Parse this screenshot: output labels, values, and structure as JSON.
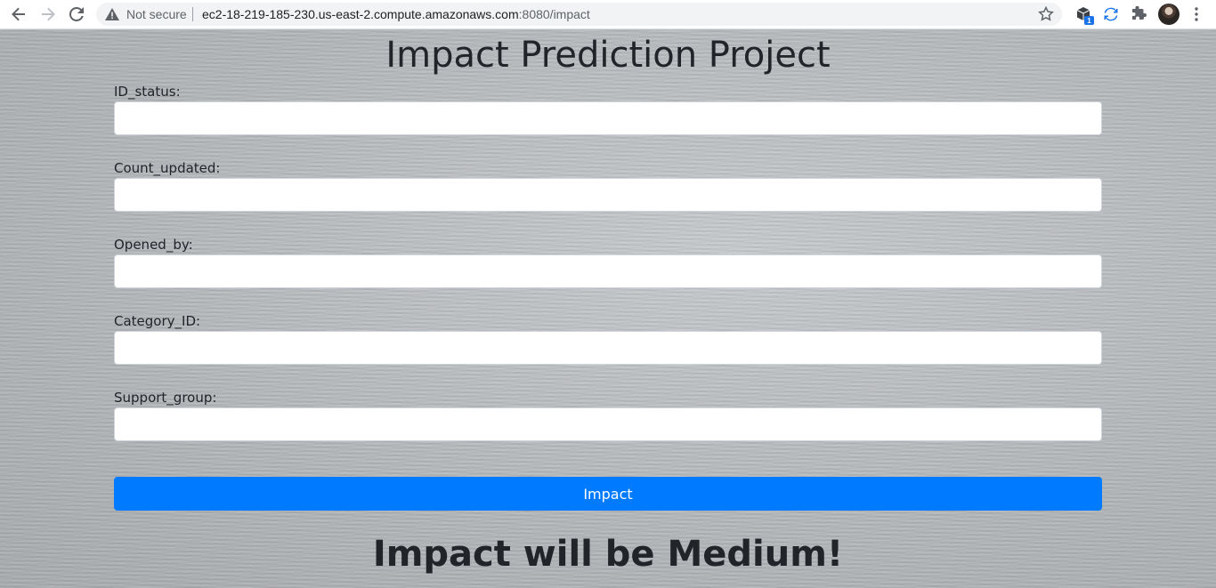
{
  "browser": {
    "security_label": "Not secure",
    "url_host": "ec2-18-219-185-230.us-east-2.compute.amazonaws.com",
    "url_path": ":8080/impact",
    "extension_badge": "1"
  },
  "page": {
    "title": "Impact Prediction Project",
    "fields": [
      {
        "label": "ID_status:",
        "value": ""
      },
      {
        "label": "Count_updated:",
        "value": ""
      },
      {
        "label": "Opened_by:",
        "value": ""
      },
      {
        "label": "Category_ID:",
        "value": ""
      },
      {
        "label": "Support_group:",
        "value": ""
      }
    ],
    "submit_label": "Impact",
    "result_text": "Impact will be Medium!"
  },
  "colors": {
    "primary_button": "#007bff",
    "text": "#212529"
  },
  "icons": [
    "back-arrow-icon",
    "forward-arrow-icon",
    "reload-icon",
    "warning-icon",
    "star-icon",
    "extension-cube-icon",
    "sync-icon",
    "puzzle-icon",
    "kebab-menu-icon"
  ]
}
